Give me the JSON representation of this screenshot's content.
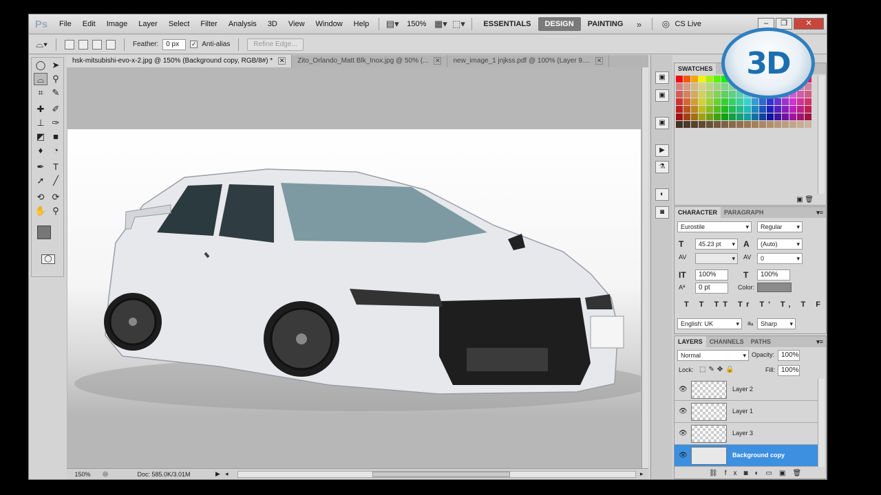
{
  "app": {
    "logo": "Ps"
  },
  "menu": [
    "File",
    "Edit",
    "Image",
    "Layer",
    "Select",
    "Filter",
    "Analysis",
    "3D",
    "View",
    "Window",
    "Help"
  ],
  "zoom_menu": "150%",
  "workspaces": [
    "ESSENTIALS",
    "DESIGN",
    "PAINTING"
  ],
  "active_workspace": "DESIGN",
  "cs_live": "CS Live",
  "options": {
    "feather_label": "Feather:",
    "feather_value": "0 px",
    "antialias_label": "Anti-alias",
    "antialias_checked": true,
    "refine_edge": "Refine Edge..."
  },
  "tabs": [
    {
      "label": "hsk-mitsubishi-evo-x-2.jpg @ 150% (Background copy, RGB/8#) *",
      "active": true
    },
    {
      "label": "Zito_Orlando_Matt Blk_Inox.jpg @ 50% (...",
      "active": false
    },
    {
      "label": "new_image_1 jnjkss.pdf @ 100% (Layer 9....",
      "active": false
    }
  ],
  "status": {
    "zoom": "150%",
    "doc": "Doc: 585.0K/3.01M"
  },
  "swatches": {
    "title": "SWATCHES"
  },
  "character": {
    "tabs": [
      "CHARACTER",
      "PARAGRAPH"
    ],
    "font": "Eurostile",
    "style": "Regular",
    "size": "45.23 pt",
    "leading": "(Auto)",
    "kerning": "",
    "tracking": "0",
    "vscale": "100%",
    "hscale": "100%",
    "baseline": "0 pt",
    "color_label": "Color:",
    "language": "English: UK",
    "aa_label": "aₐ",
    "antialias": "Sharp"
  },
  "layers_panel": {
    "tabs": [
      "LAYERS",
      "CHANNELS",
      "PATHS"
    ],
    "blend": "Normal",
    "opacity_label": "Opacity:",
    "opacity": "100%",
    "lock_label": "Lock:",
    "fill_label": "Fill:",
    "fill": "100%",
    "layers": [
      {
        "name": "Layer 2",
        "selected": false
      },
      {
        "name": "Layer 1",
        "selected": false
      },
      {
        "name": "Layer 3",
        "selected": false
      },
      {
        "name": "Background copy",
        "selected": true
      }
    ]
  },
  "watermark": "3D",
  "colors": {
    "accent": "#3d8fe0",
    "workspace_active": "#7a7a7a",
    "close": "#c9463c"
  }
}
